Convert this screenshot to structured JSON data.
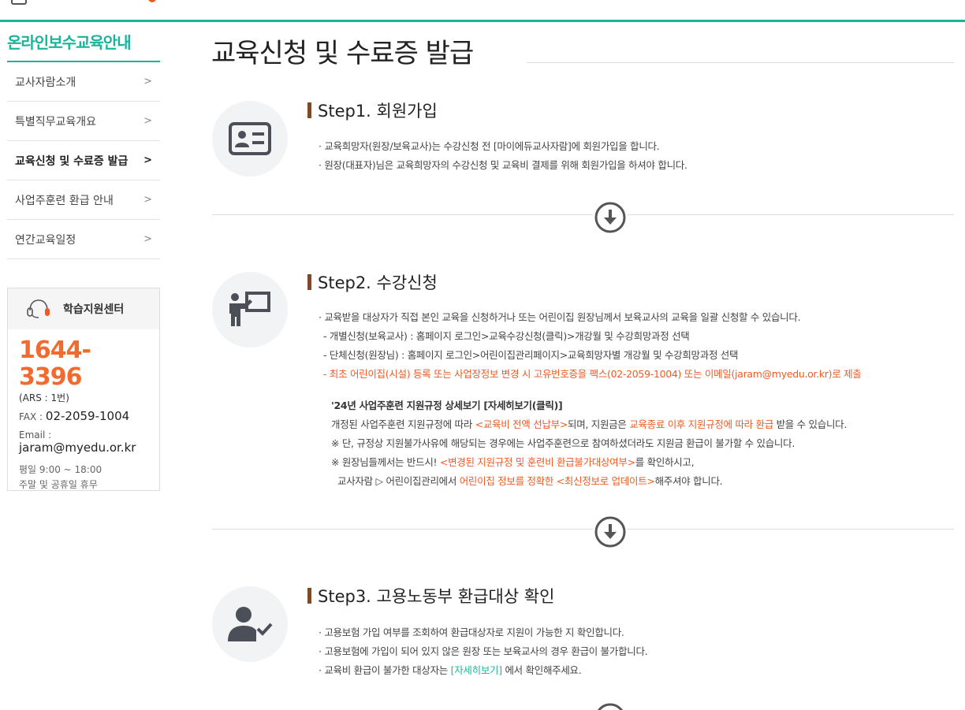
{
  "sidebar": {
    "title": "온라인보수교육안내",
    "items": [
      {
        "label": "교사자람소개"
      },
      {
        "label": "특별직무교육개요"
      },
      {
        "label": "교육신청 및 수료증 발급"
      },
      {
        "label": "사업주훈련 환급 안내"
      },
      {
        "label": "연간교육일정"
      }
    ],
    "chevron": ">"
  },
  "support": {
    "title": "학습지원센터",
    "phone": "1644-3396",
    "ars": "(ARS : 1번)",
    "fax_label": "FAX : ",
    "fax": "02-2059-1004",
    "email_label": "Email :",
    "email": "jaram@myedu.or.kr",
    "hours1": "평일 9:00 ~ 18:00",
    "hours2": "주말 및 공휴일 휴무"
  },
  "page": {
    "title": "교육신청 및 수료증 발급"
  },
  "step1": {
    "title": "Step1. 회원가입",
    "line1": "· 교육희망자(원장/보육교사)는 수강신청 전 [마이에듀교사자람]에 회원가입을 합니다.",
    "line2": "· 원장(대표자)님은 교육희망자의 수강신청 및 교육비 결제를 위해 회원가입을 하셔야 합니다."
  },
  "step2": {
    "title": "Step2. 수강신청",
    "line1": "· 교육받을 대상자가 직접 본인 교육을 신청하거나 또는 어린이집 원장님께서 보육교사의 교육을 일괄 신청할 수 있습니다.",
    "line2": "- 개별신청(보육교사) : 홈페이지 로그인>교육수강신청(클릭)>개강월 및 수강희망과정 선택",
    "line3": "- 단체신청(원장님) : 홈페이지 로그인>어린이집관리페이지>교육희망자별 개강월 및 수강희망과정 선택",
    "line4": "- 최초 어린이집(시설) 등록 또는 사업장정보 변경 시 고유번호증을 팩스(02-2059-1004) 또는 이메일(jaram@myedu.or.kr)로 제출",
    "sub_title": "'24년 사업주훈련 지원규정 상세보기 ",
    "sub_link": "[자세히보기(클릭)]",
    "sub1_a": "개정된 사업주훈련 지원규정에 따라 ",
    "sub1_b": "<교육비 전액 선납부>",
    "sub1_c": "되며, 지원금은 ",
    "sub1_d": "교육종료 이후 지원규정에 따라 환급",
    "sub1_e": " 받을 수 있습니다.",
    "sub2": "※ 단, 규정상 지원불가사유에 해당되는 경우에는 사업주훈련으로 참여하셨더라도 지원금 환급이 불가할 수 있습니다.",
    "sub3_a": "※ 원장님들께서는 반드시! ",
    "sub3_b": "<변경된 지원규정 및 훈련비 환급불가대상여부>",
    "sub3_c": "를 확인하시고,",
    "sub4_a": "교사자람 ▷ 어린이집관리에서 ",
    "sub4_b": "어린이집 정보를 정확한 <최신정보로 업데이트>",
    "sub4_c": "해주셔야 합니다."
  },
  "step3": {
    "title": "Step3. 고용노동부 환급대상 확인",
    "line1": "· 고용보험 가입 여부를 조회하여 환급대상자로 지원이 가능한 지 확인합니다.",
    "line2": "· 고용보험에 가입이 되어 있지 않은 원장 또는 보육교사의 경우 환급이 불가합니다.",
    "line3_a": "· 교육비 환급이 불가한 대상자는 ",
    "line3_b": "[자세히보기]",
    "line3_c": " 에서 확인해주세요."
  },
  "colors": {
    "accent": "#1bb49a",
    "orange": "#ef5a24",
    "brown": "#7a4b2a"
  }
}
